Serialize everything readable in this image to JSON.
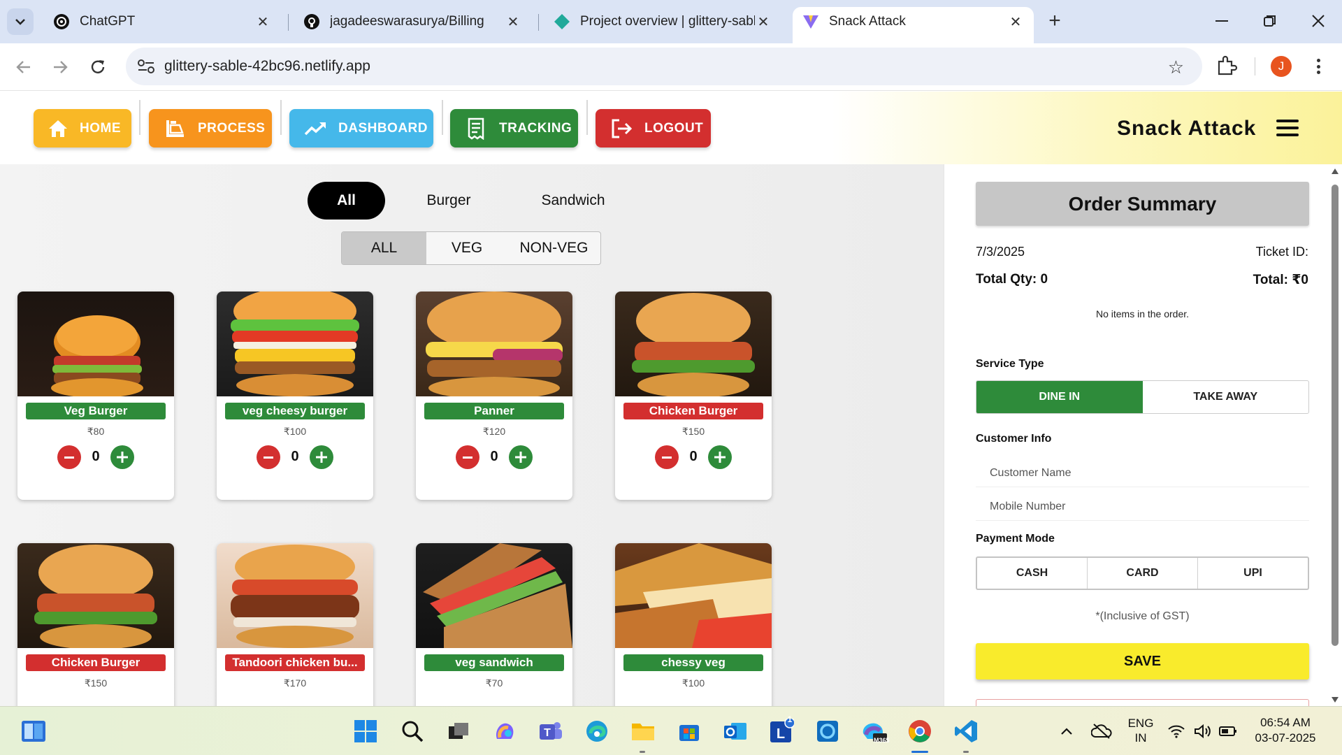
{
  "browser": {
    "tabs": [
      {
        "title": "ChatGPT",
        "icon": "chatgpt-icon"
      },
      {
        "title": "jagadeeswarasurya/Billing",
        "icon": "github-icon"
      },
      {
        "title": "Project overview | glittery-sable",
        "icon": "netlify-icon"
      },
      {
        "title": "Snack Attack",
        "icon": "vite-icon",
        "active": true
      }
    ],
    "url": "glittery-sable-42bc96.netlify.app",
    "profile_initial": "J"
  },
  "header": {
    "nav": [
      {
        "label": "HOME",
        "color": "#f9b826",
        "icon": "home-icon"
      },
      {
        "label": "PROCESS",
        "color": "#f7941d",
        "icon": "process-icon"
      },
      {
        "label": "DASHBOARD",
        "color": "#45b8ea",
        "icon": "trending-up-icon"
      },
      {
        "label": "TRACKING",
        "color": "#2e8b3a",
        "icon": "receipt-icon"
      },
      {
        "label": "LOGOUT",
        "color": "#d32f2f",
        "icon": "logout-icon"
      }
    ],
    "brand": "Snack Attack"
  },
  "menu": {
    "categories": [
      "All",
      "Burger",
      "Sandwich"
    ],
    "active_category": "All",
    "filters": [
      "ALL",
      "VEG",
      "NON-VEG"
    ],
    "active_filter": "ALL",
    "items": [
      {
        "name": "Veg Burger",
        "price": "₹80",
        "qty": "0",
        "veg": true,
        "color": "#2e8b3a"
      },
      {
        "name": "veg cheesy burger",
        "price": "₹100",
        "qty": "0",
        "veg": true,
        "color": "#2e8b3a"
      },
      {
        "name": "Panner",
        "price": "₹120",
        "qty": "0",
        "veg": true,
        "color": "#2e8b3a"
      },
      {
        "name": "Chicken Burger",
        "price": "₹150",
        "qty": "0",
        "veg": false,
        "color": "#d32f2f"
      },
      {
        "name": "Chicken Burger",
        "price": "₹150",
        "qty": "0",
        "veg": false,
        "color": "#d32f2f"
      },
      {
        "name": "Tandoori chicken bu...",
        "price": "₹170",
        "qty": "0",
        "veg": false,
        "color": "#d32f2f"
      },
      {
        "name": "veg sandwich",
        "price": "₹70",
        "qty": "0",
        "veg": true,
        "color": "#2e8b3a"
      },
      {
        "name": "chessy veg",
        "price": "₹100",
        "qty": "0",
        "veg": true,
        "color": "#2e8b3a"
      }
    ]
  },
  "order": {
    "title": "Order Summary",
    "date": "7/3/2025",
    "ticket_label": "Ticket ID:",
    "total_qty_label": "Total Qty: 0",
    "total_label": "Total: ₹0",
    "empty_text": "No items in the order.",
    "service_type_label": "Service Type",
    "service_options": [
      "DINE IN",
      "TAKE AWAY"
    ],
    "active_service": "DINE IN",
    "customer_info_label": "Customer Info",
    "customer_name_placeholder": "Customer Name",
    "mobile_placeholder": "Mobile Number",
    "payment_mode_label": "Payment Mode",
    "payment_options": [
      "CASH",
      "CARD",
      "UPI"
    ],
    "gst_note": "*(Inclusive of GST)",
    "save_label": "SAVE"
  },
  "taskbar": {
    "language": "ENG",
    "region": "IN",
    "time": "06:54 AM",
    "date": "03-07-2025",
    "outlook_badge": "1",
    "m365_label": "M365"
  }
}
